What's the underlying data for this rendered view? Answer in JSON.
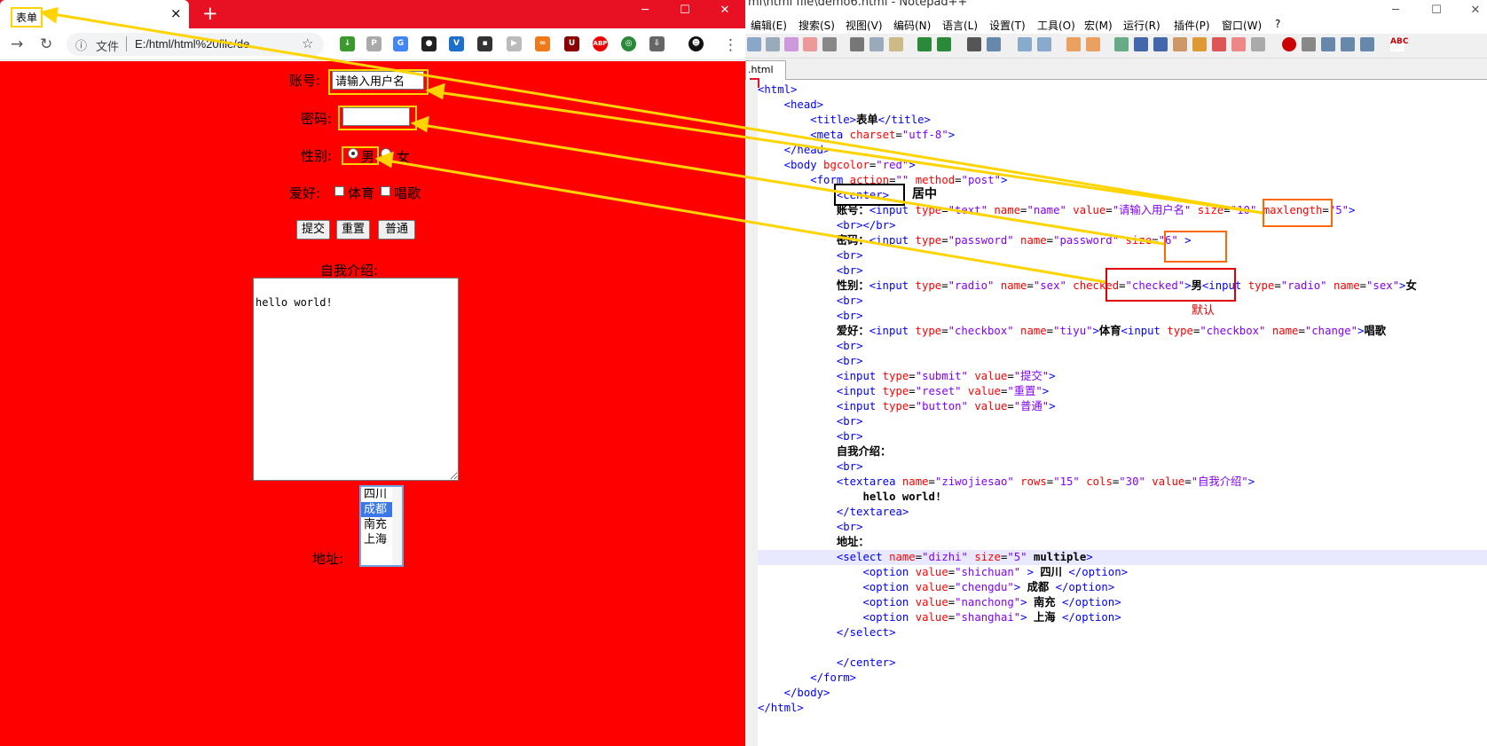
{
  "browser": {
    "tab_title": "表单",
    "tab_close": "×",
    "new_tab": "+",
    "scheme": "文件",
    "url": "E:/html/html%20file/de",
    "form": {
      "account_label": "账号:",
      "account_value": "请输入用户名",
      "password_label": "密码:",
      "gender_label": "性别:",
      "gender_options": [
        "男",
        "女"
      ],
      "hobby_label": "爱好:",
      "hobby_options": [
        "体育",
        "唱歌"
      ],
      "submit_label": "提交",
      "reset_label": "重置",
      "button_label": "普通",
      "intro_label": "自我介绍:",
      "textarea_value": "hello world!",
      "address_label": "地址:",
      "select_options": [
        "四川",
        "成都",
        "南充",
        "上海"
      ],
      "select_selected": "成都"
    }
  },
  "notepad": {
    "title": "ml\\html file\\demo6.html - Notepad++",
    "menus": [
      "编辑(E)",
      "搜索(S)",
      "视图(V)",
      "编码(N)",
      "语言(L)",
      "设置(T)",
      "工具(O)",
      "宏(M)",
      "运行(R)",
      "插件(P)",
      "窗口(W)",
      "?"
    ],
    "file_tab": ".html",
    "notes": {
      "center": "居中",
      "default": "默认"
    },
    "code": [
      [
        "t",
        "<html>"
      ],
      [
        "t",
        "    <head>"
      ],
      [
        "m",
        "        <title>",
        "表单",
        "</title>"
      ],
      [
        "m2",
        "        <meta charset=\"utf-8\">"
      ],
      [
        "t",
        "    </head>"
      ],
      [
        "m2",
        "    <body bgcolor=\"red\">"
      ],
      [
        "m2",
        "        <form action=\"\" method=\"post\">"
      ],
      [
        "t",
        "            <center>"
      ],
      [
        "m3",
        "            账号：<input type=\"text\" name=\"name\" value=\"请输入用户名\" size=\"10\" maxlength=\"5\">"
      ],
      [
        "t",
        "            <br></br>"
      ],
      [
        "m3",
        "            密码：<input type=\"password\" name=\"password\" size=\"6\" >"
      ],
      [
        "t",
        "            <br>"
      ],
      [
        "t",
        "            <br>"
      ],
      [
        "m3",
        "            性别：<input type=\"radio\" name=\"sex\" checked=\"checked\">男<input type=\"radio\" name=\"sex\">女"
      ],
      [
        "t",
        "            <br>"
      ],
      [
        "t",
        "            <br>"
      ],
      [
        "m3",
        "            爱好：<input type=\"checkbox\" name=\"tiyu\">体育<input type=\"checkbox\" name=\"change\">唱歌"
      ],
      [
        "t",
        "            <br>"
      ],
      [
        "t",
        "            <br>"
      ],
      [
        "m3",
        "            <input type=\"submit\" value=\"提交\">"
      ],
      [
        "m3",
        "            <input type=\"reset\" value=\"重置\">"
      ],
      [
        "m3",
        "            <input type=\"button\" value=\"普通\">"
      ],
      [
        "t",
        "            <br>"
      ],
      [
        "t",
        "            <br>"
      ],
      [
        "k",
        "            自我介绍："
      ],
      [
        "t",
        "            <br>"
      ],
      [
        "m3",
        "            <textarea name=\"ziwojiesao\" rows=\"15\" cols=\"30\" value=\"自我介绍\">"
      ],
      [
        "k",
        "                hello world!"
      ],
      [
        "t",
        "            </textarea>"
      ],
      [
        "t",
        "            <br>"
      ],
      [
        "k",
        "            地址："
      ],
      [
        "m3",
        "            <select name=\"dizhi\" size=\"5\" multiple>"
      ],
      [
        "m3",
        "                <option value=\"shichuan\" > 四川 </option>"
      ],
      [
        "m3",
        "                <option value=\"chengdu\"> 成都 </option>"
      ],
      [
        "m3",
        "                <option value=\"nanchong\"> 南充 </option>"
      ],
      [
        "m3",
        "                <option value=\"shanghai\"> 上海 </option>"
      ],
      [
        "t",
        "            </select>"
      ],
      [
        "t",
        ""
      ],
      [
        "t",
        "            </center>"
      ],
      [
        "t",
        "        </form>"
      ],
      [
        "t",
        "    </body>"
      ],
      [
        "t",
        "</html>"
      ]
    ]
  },
  "colors": {
    "page_bg": "#ff0000",
    "tabstrip": "#e81123",
    "annotation": "#ffd400",
    "highlight_box": "#ff6a00"
  }
}
